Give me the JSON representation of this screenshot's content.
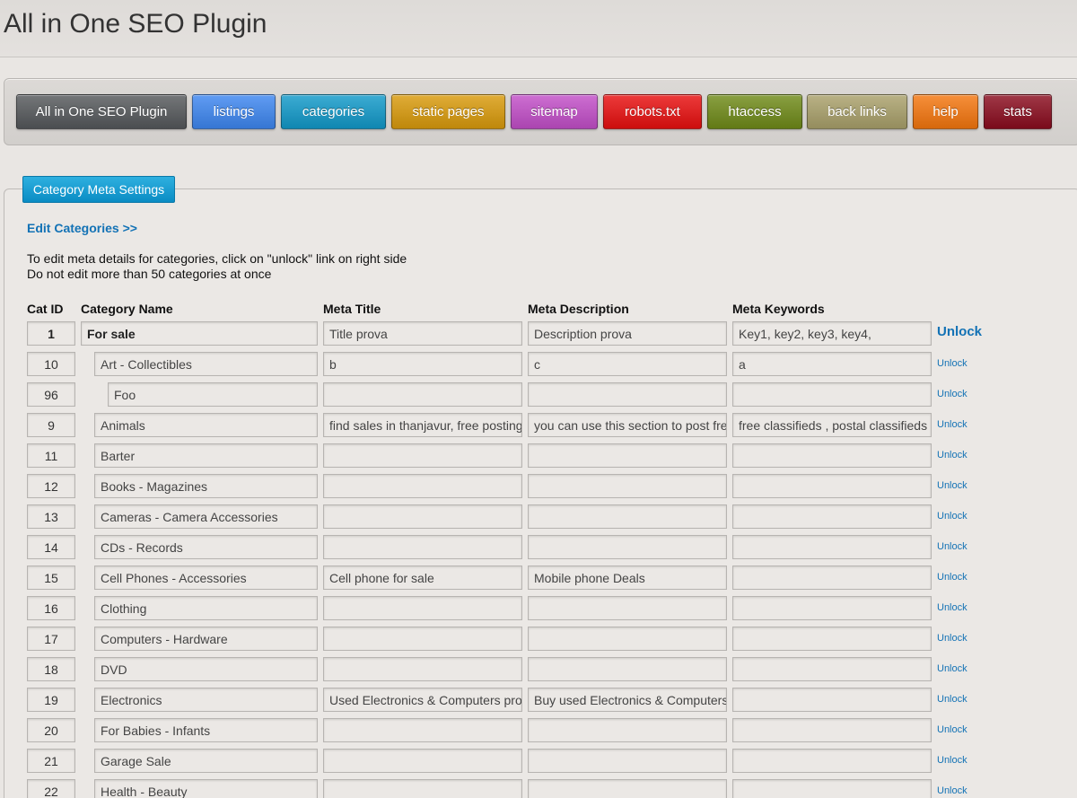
{
  "page_title": "All in One SEO Plugin",
  "nav": [
    {
      "label": "All in One SEO Plugin",
      "color": "#55585b"
    },
    {
      "label": "listings",
      "color": "#3d86f0"
    },
    {
      "label": "categories",
      "color": "#1199c9"
    },
    {
      "label": "static pages",
      "color": "#d99a0b"
    },
    {
      "label": "sitemap",
      "color": "#c24ec8"
    },
    {
      "label": "robots.txt",
      "color": "#e80f0f"
    },
    {
      "label": "htaccess",
      "color": "#6f8a18"
    },
    {
      "label": "back links",
      "color": "#a9a06a"
    },
    {
      "label": "help",
      "color": "#f4760e"
    },
    {
      "label": "stats",
      "color": "#8a0c1e"
    }
  ],
  "panel": {
    "tab_label": "Category Meta Settings",
    "edit_link": "Edit Categories >>",
    "instruction_1": "To edit meta details for categories, click on \"unlock\" link on right side",
    "instruction_2": "Do not edit more than 50 categories at once"
  },
  "columns": {
    "cat_id": "Cat ID",
    "name": "Category Name",
    "title": "Meta Title",
    "desc": "Meta Description",
    "keywords": "Meta Keywords"
  },
  "unlock_label": "Unlock",
  "rows": [
    {
      "id": "1",
      "name": "For sale",
      "level": 0,
      "title": "Title prova",
      "desc": "Description prova",
      "keywords": "Key1, key2, key3, key4,"
    },
    {
      "id": "10",
      "name": "Art - Collectibles",
      "level": 1,
      "title": "b",
      "desc": "c",
      "keywords": "a"
    },
    {
      "id": "96",
      "name": "Foo",
      "level": 2,
      "title": "",
      "desc": "",
      "keywords": ""
    },
    {
      "id": "9",
      "name": "Animals",
      "level": 1,
      "title": "find sales in thanjavur, free posting f",
      "desc": "you can use this section to post free",
      "keywords": "free classifieds , postal classifieds ,"
    },
    {
      "id": "11",
      "name": "Barter",
      "level": 1,
      "title": "",
      "desc": "",
      "keywords": ""
    },
    {
      "id": "12",
      "name": "Books - Magazines",
      "level": 1,
      "title": "",
      "desc": "",
      "keywords": ""
    },
    {
      "id": "13",
      "name": "Cameras - Camera Accessories",
      "level": 1,
      "title": "",
      "desc": "",
      "keywords": ""
    },
    {
      "id": "14",
      "name": "CDs - Records",
      "level": 1,
      "title": "",
      "desc": "",
      "keywords": ""
    },
    {
      "id": "15",
      "name": "Cell Phones - Accessories",
      "level": 1,
      "title": "Cell phone for sale",
      "desc": "Mobile phone Deals",
      "keywords": ""
    },
    {
      "id": "16",
      "name": "Clothing",
      "level": 1,
      "title": "",
      "desc": "",
      "keywords": ""
    },
    {
      "id": "17",
      "name": "Computers - Hardware",
      "level": 1,
      "title": "",
      "desc": "",
      "keywords": ""
    },
    {
      "id": "18",
      "name": "DVD",
      "level": 1,
      "title": "",
      "desc": "",
      "keywords": ""
    },
    {
      "id": "19",
      "name": "Electronics",
      "level": 1,
      "title": "Used Electronics & Computers proc",
      "desc": "Buy used Electronics & Computers",
      "keywords": ""
    },
    {
      "id": "20",
      "name": "For Babies - Infants",
      "level": 1,
      "title": "",
      "desc": "",
      "keywords": ""
    },
    {
      "id": "21",
      "name": "Garage Sale",
      "level": 1,
      "title": "",
      "desc": "",
      "keywords": ""
    },
    {
      "id": "22",
      "name": "Health - Beauty",
      "level": 1,
      "title": "",
      "desc": "",
      "keywords": ""
    }
  ]
}
